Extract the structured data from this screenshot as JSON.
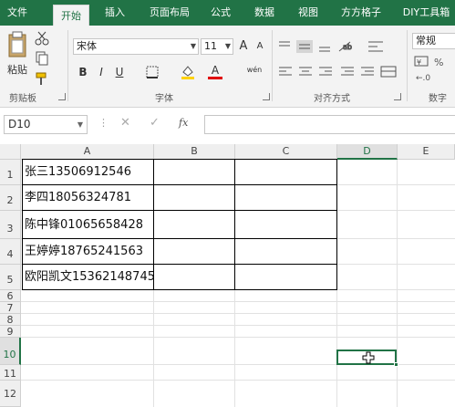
{
  "ribbon_tabs": [
    "文件",
    "开始",
    "插入",
    "页面布局",
    "公式",
    "数据",
    "视图",
    "方方格子",
    "DIY工具箱"
  ],
  "active_tab": "开始",
  "clipboard": {
    "paste_label": "粘贴",
    "group_label": "剪贴板"
  },
  "font": {
    "name": "宋体",
    "size": "11",
    "group_label": "字体",
    "bold": "B",
    "italic": "I",
    "underline": "U",
    "grow": "A",
    "shrink": "A",
    "phonetic": "wén"
  },
  "alignment": {
    "group_label": "对齐方式"
  },
  "number": {
    "format": "常规",
    "group_label": "数字"
  },
  "formula_bar": {
    "name_box": "D10",
    "fx": "fx",
    "content": ""
  },
  "columns": [
    "A",
    "B",
    "C",
    "D",
    "E"
  ],
  "selected_column": "D",
  "rows": [
    "1",
    "2",
    "3",
    "4",
    "5",
    "6",
    "7",
    "8",
    "9",
    "10",
    "11",
    "12"
  ],
  "selected_row": "10",
  "cells": {
    "A1": "张三13506912546",
    "A2": "李四18056324781",
    "A3": "陈中锋01065658428",
    "A4": "王婷婷18765241563",
    "A5": "欧阳凯文15362148745"
  },
  "colors": {
    "brand": "#217346",
    "active_tab_bg": "#f3f3f3"
  }
}
